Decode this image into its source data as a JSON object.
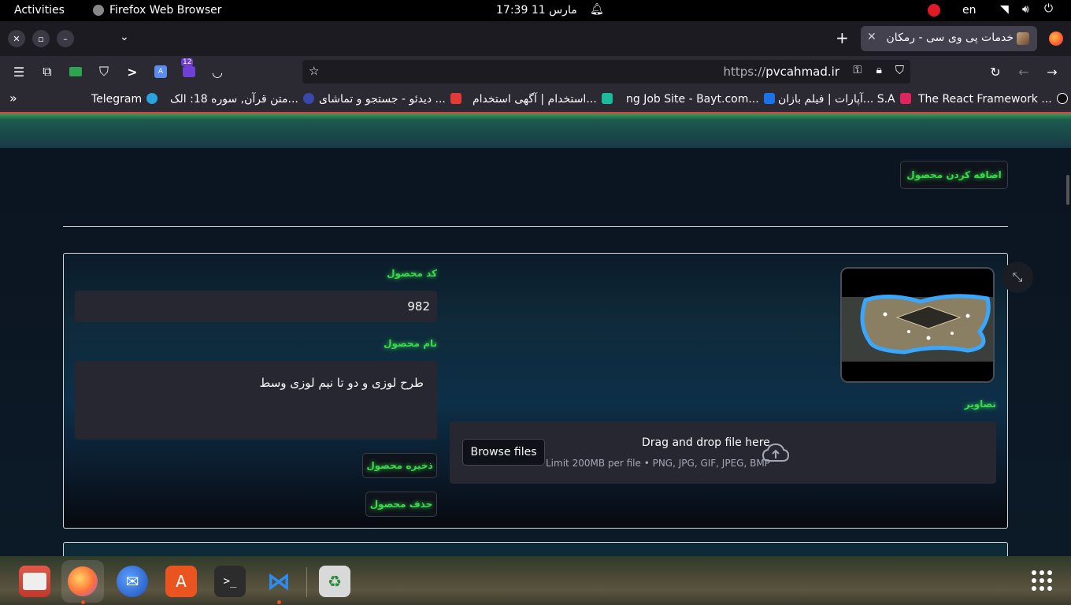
{
  "topbar": {
    "activities": "Activities",
    "app_name": "Firefox Web Browser",
    "datetime": "مارس 11  17:39",
    "lang": "en"
  },
  "tabs": {
    "active_title": "خدمات پی وی سی - رمکان"
  },
  "navbar": {
    "url_proto": "https://",
    "url_host": "pvcahmad.ir",
    "badge_count": "12"
  },
  "bookmarks": [
    {
      "label": "The React Framework ...",
      "color": "#111111"
    },
    {
      "label": "آپارات | فیلم بازان... S.A",
      "color": "#e0245e"
    },
    {
      "label": "ng Job Site - Bayt.com...",
      "color": "#1a73e8"
    },
    {
      "label": "استخدام | آگهی استخدام...",
      "color": "#1abc9c"
    },
    {
      "label": "دیدئو - جستجو و تماشای ...",
      "color": "#e53935"
    },
    {
      "label": "متن قرآن, سوره 18: الک...",
      "color": "#3949ab"
    },
    {
      "label": "Telegram",
      "color": "#2aa3df"
    }
  ],
  "page": {
    "add_product_button": "اضافه کردن محصول",
    "product_code_label": "کد محصول",
    "product_code_value": "982",
    "product_name_label": "نام محصول",
    "product_name_value": "طرح لوزی و دو تا نیم لوزی وسط",
    "images_label": "تصاویر",
    "save_button": "ذخیره محصول",
    "delete_button": "حذف محصول",
    "uploader": {
      "drag_text": "Drag and drop file here",
      "limit_text": "Limit 200MB per file • PNG, JPG, GIF, JPEG, BMP",
      "browse_label": "Browse files"
    }
  },
  "dock": {
    "apps": [
      "files-icon",
      "firefox-icon",
      "thunderbird-icon",
      "app-center-icon",
      "terminal-icon",
      "vscode-icon",
      "trash-icon"
    ]
  }
}
